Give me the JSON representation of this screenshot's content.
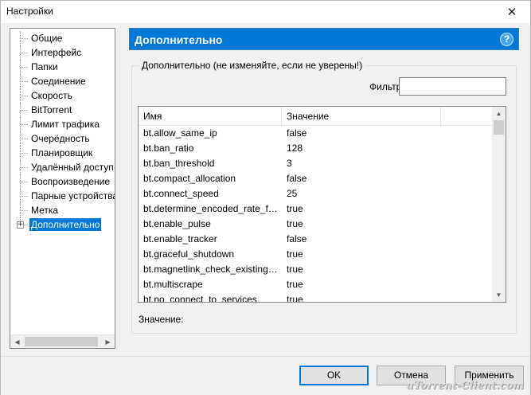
{
  "window": {
    "title": "Настройки",
    "close_glyph": "✕"
  },
  "tree": {
    "items": [
      {
        "label": "Общие"
      },
      {
        "label": "Интерфейс"
      },
      {
        "label": "Папки"
      },
      {
        "label": "Соединение"
      },
      {
        "label": "Скорость"
      },
      {
        "label": "BitTorrent"
      },
      {
        "label": "Лимит трафика"
      },
      {
        "label": "Очерёдность"
      },
      {
        "label": "Планировщик"
      },
      {
        "label": "Удалённый доступ"
      },
      {
        "label": "Воспроизведение"
      },
      {
        "label": "Парные устройства"
      },
      {
        "label": "Метка"
      },
      {
        "label": "Дополнительно",
        "selected": true,
        "expander": "+"
      }
    ]
  },
  "panel": {
    "title": "Дополнительно",
    "help_glyph": "?",
    "group_title": "Дополнительно (не изменяйте, если не уверены!)",
    "filter_label": "Фильтр",
    "filter_value": "",
    "columns": {
      "name": "Имя",
      "value": "Значение"
    },
    "rows": [
      {
        "name": "bt.allow_same_ip",
        "value": "false"
      },
      {
        "name": "bt.ban_ratio",
        "value": "128"
      },
      {
        "name": "bt.ban_threshold",
        "value": "3"
      },
      {
        "name": "bt.compact_allocation",
        "value": "false"
      },
      {
        "name": "bt.connect_speed",
        "value": "25"
      },
      {
        "name": "bt.determine_encoded_rate_fo...",
        "value": "true"
      },
      {
        "name": "bt.enable_pulse",
        "value": "true"
      },
      {
        "name": "bt.enable_tracker",
        "value": "false"
      },
      {
        "name": "bt.graceful_shutdown",
        "value": "true"
      },
      {
        "name": "bt.magnetlink_check_existing_...",
        "value": "true"
      },
      {
        "name": "bt.multiscrape",
        "value": "true"
      },
      {
        "name": "bt.no_connect_to_services",
        "value": "true"
      }
    ],
    "value_label": "Значение:"
  },
  "buttons": {
    "ok": "OK",
    "cancel": "Отмена",
    "apply": "Применить"
  },
  "watermark": "uTorrent-Client.com",
  "colors": {
    "accent": "#0078d7"
  }
}
